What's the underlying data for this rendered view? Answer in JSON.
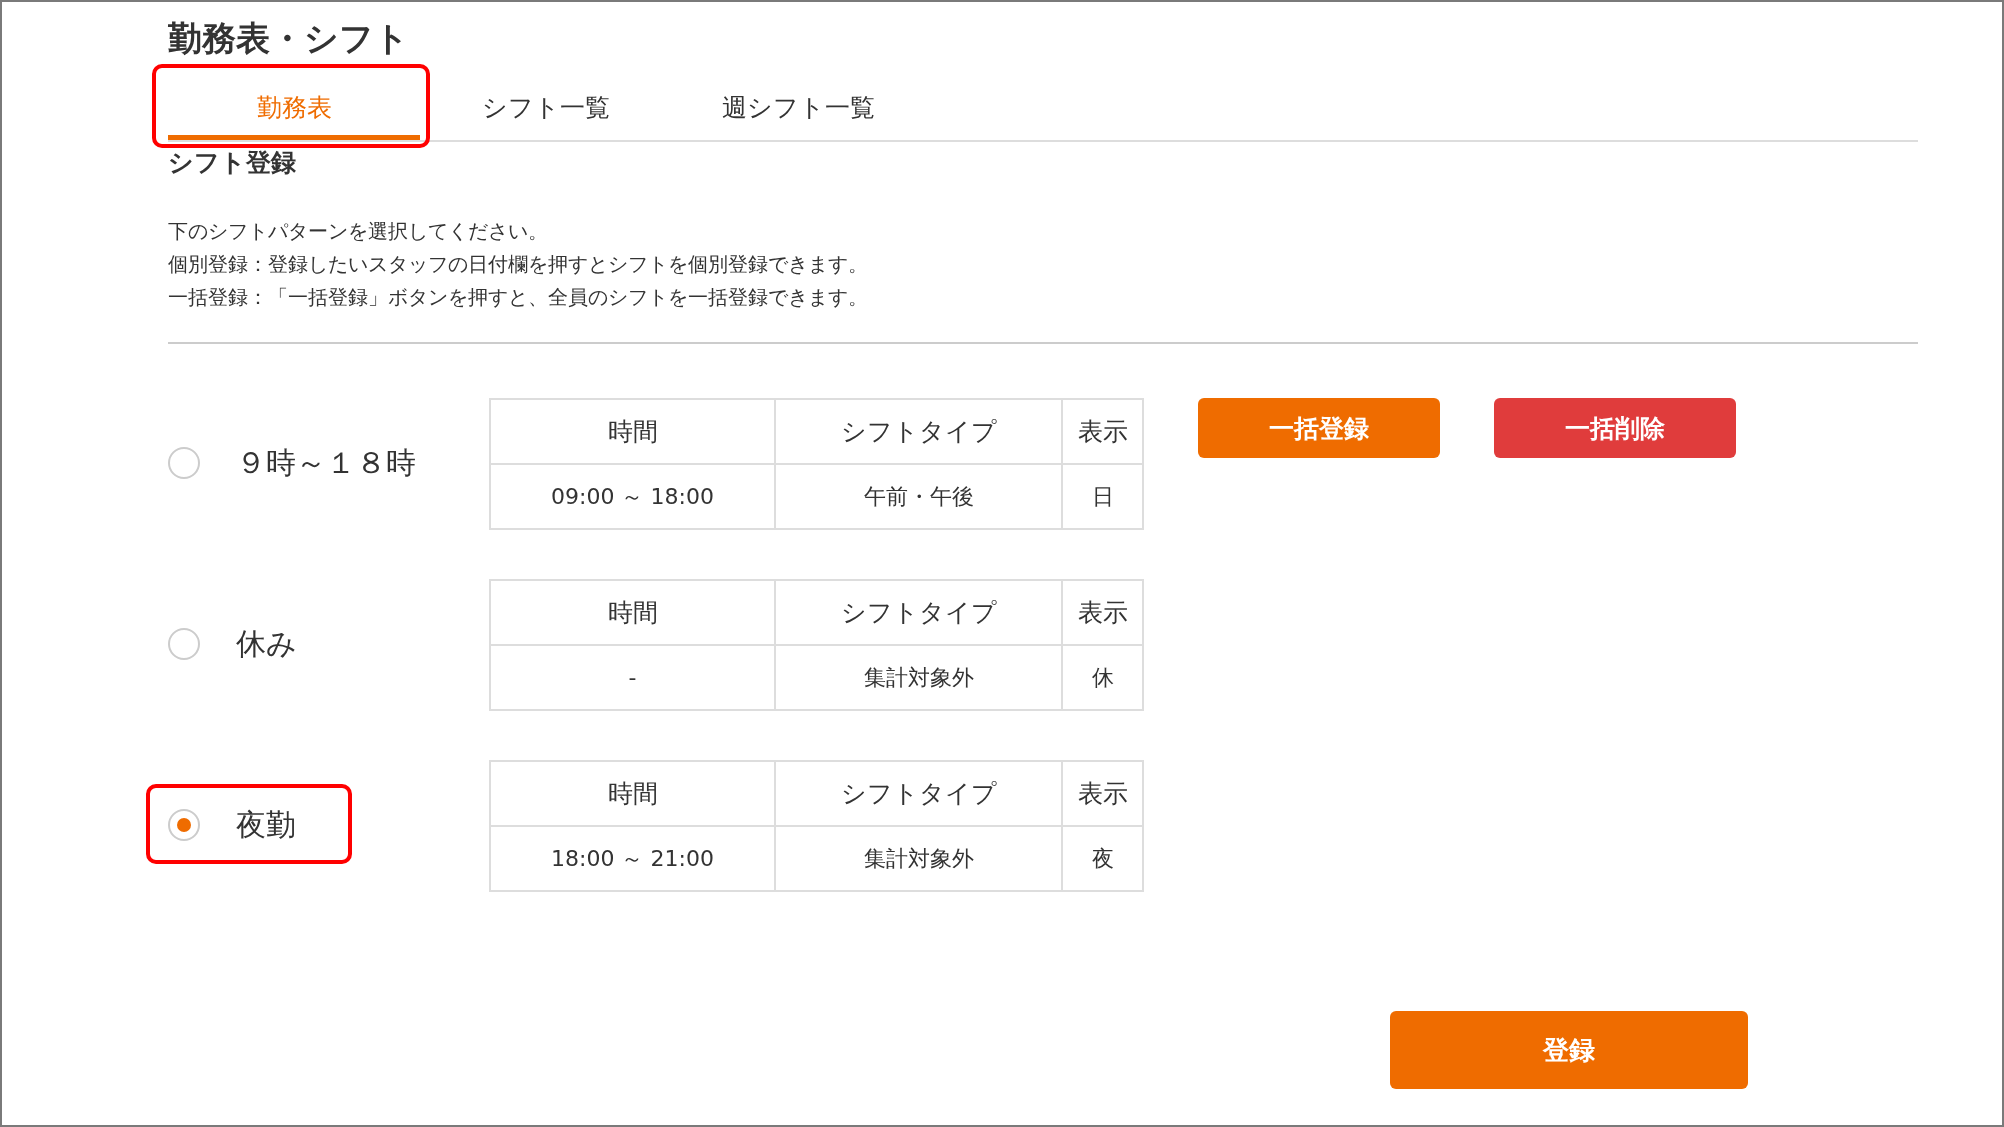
{
  "title": "勤務表・シフト",
  "tabs": [
    {
      "label": "勤務表",
      "selected": true,
      "highlighted": true
    },
    {
      "label": "シフト一覧",
      "selected": false,
      "highlighted": false
    },
    {
      "label": "週シフト一覧",
      "selected": false,
      "highlighted": false
    }
  ],
  "section_title": "シフト登録",
  "instructions": [
    "下のシフトパターンを選択してください。",
    "個別登録：登録したいスタッフの日付欄を押すとシフトを個別登録できます。",
    "一括登録：「一括登録」ボタンを押すと、全員のシフトを一括登録できます。"
  ],
  "patterns": [
    {
      "label": "９時～１８時",
      "selected": false,
      "highlighted": false,
      "columns": [
        "時間",
        "シフトタイプ",
        "表示"
      ],
      "values": [
        "09:00 ～ 18:00",
        "午前・午後",
        "日"
      ]
    },
    {
      "label": "休み",
      "selected": false,
      "highlighted": false,
      "columns": [
        "時間",
        "シフトタイプ",
        "表示"
      ],
      "values": [
        "-",
        "集計対象外",
        "休"
      ]
    },
    {
      "label": "夜勤",
      "selected": true,
      "highlighted": true,
      "columns": [
        "時間",
        "シフトタイプ",
        "表示"
      ],
      "values": [
        "18:00 ～ 21:00",
        "集計対象外",
        "夜"
      ]
    }
  ],
  "bulk_buttons": [
    {
      "label": "一括登録",
      "kind": "primary"
    },
    {
      "label": "一括削除",
      "kind": "danger"
    }
  ],
  "submit_button": "登録"
}
